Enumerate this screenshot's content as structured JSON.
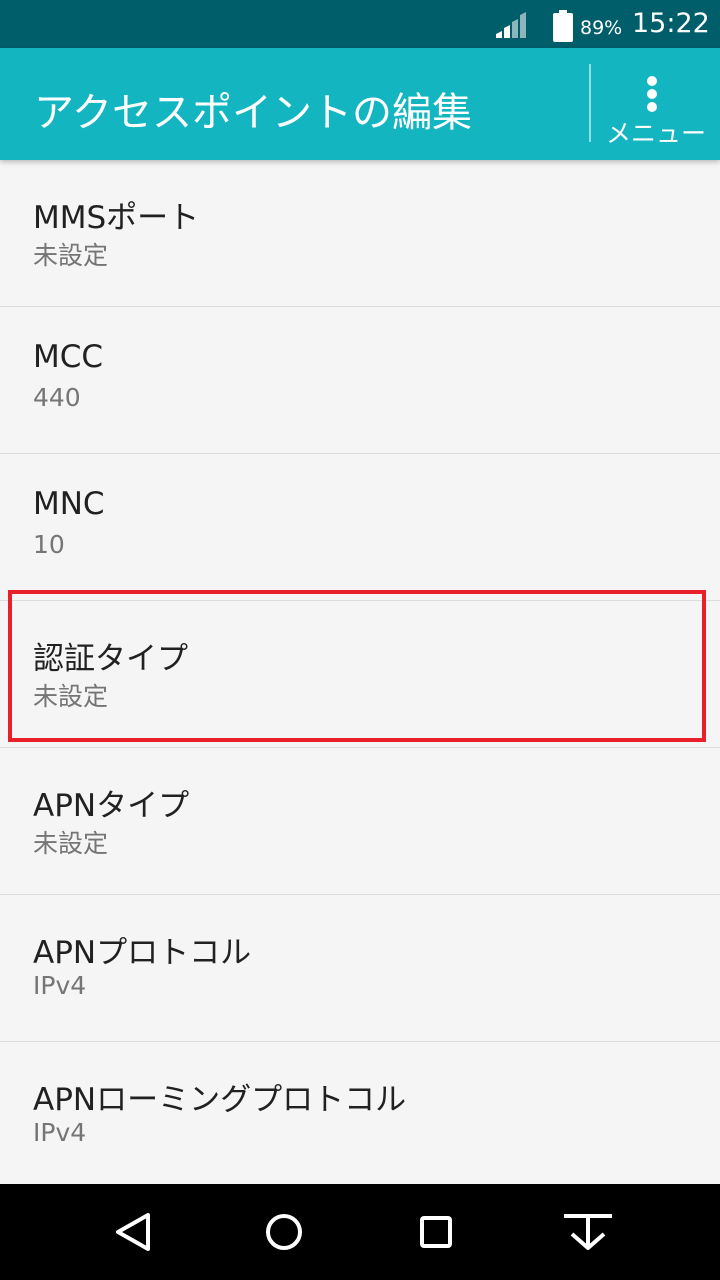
{
  "status_bar": {
    "battery_percent": "89%",
    "time": "15:22",
    "icons": [
      "signal-icon",
      "battery-icon"
    ]
  },
  "app_bar": {
    "title": "アクセスポイントの編集",
    "menu_label": "メニュー",
    "menu_icon": "more-vert-icon"
  },
  "settings": {
    "items": [
      {
        "title": "MMSポート",
        "value": "未設定"
      },
      {
        "title": "MCC",
        "value": "440"
      },
      {
        "title": "MNC",
        "value": "10"
      },
      {
        "title": "認証タイプ",
        "value": "未設定",
        "highlighted": true
      },
      {
        "title": "APNタイプ",
        "value": "未設定"
      },
      {
        "title": "APNプロトコル",
        "value": "IPv4"
      },
      {
        "title": "APNローミングプロトコル",
        "value": "IPv4"
      }
    ]
  },
  "colors": {
    "status_bar": "#005e6a",
    "app_bar": "#13b5c1",
    "highlight": "#e8202a",
    "background": "#f5f5f5"
  },
  "nav_bar": {
    "icons": [
      "back-icon",
      "home-icon",
      "recents-icon",
      "hide-nav-icon"
    ]
  }
}
